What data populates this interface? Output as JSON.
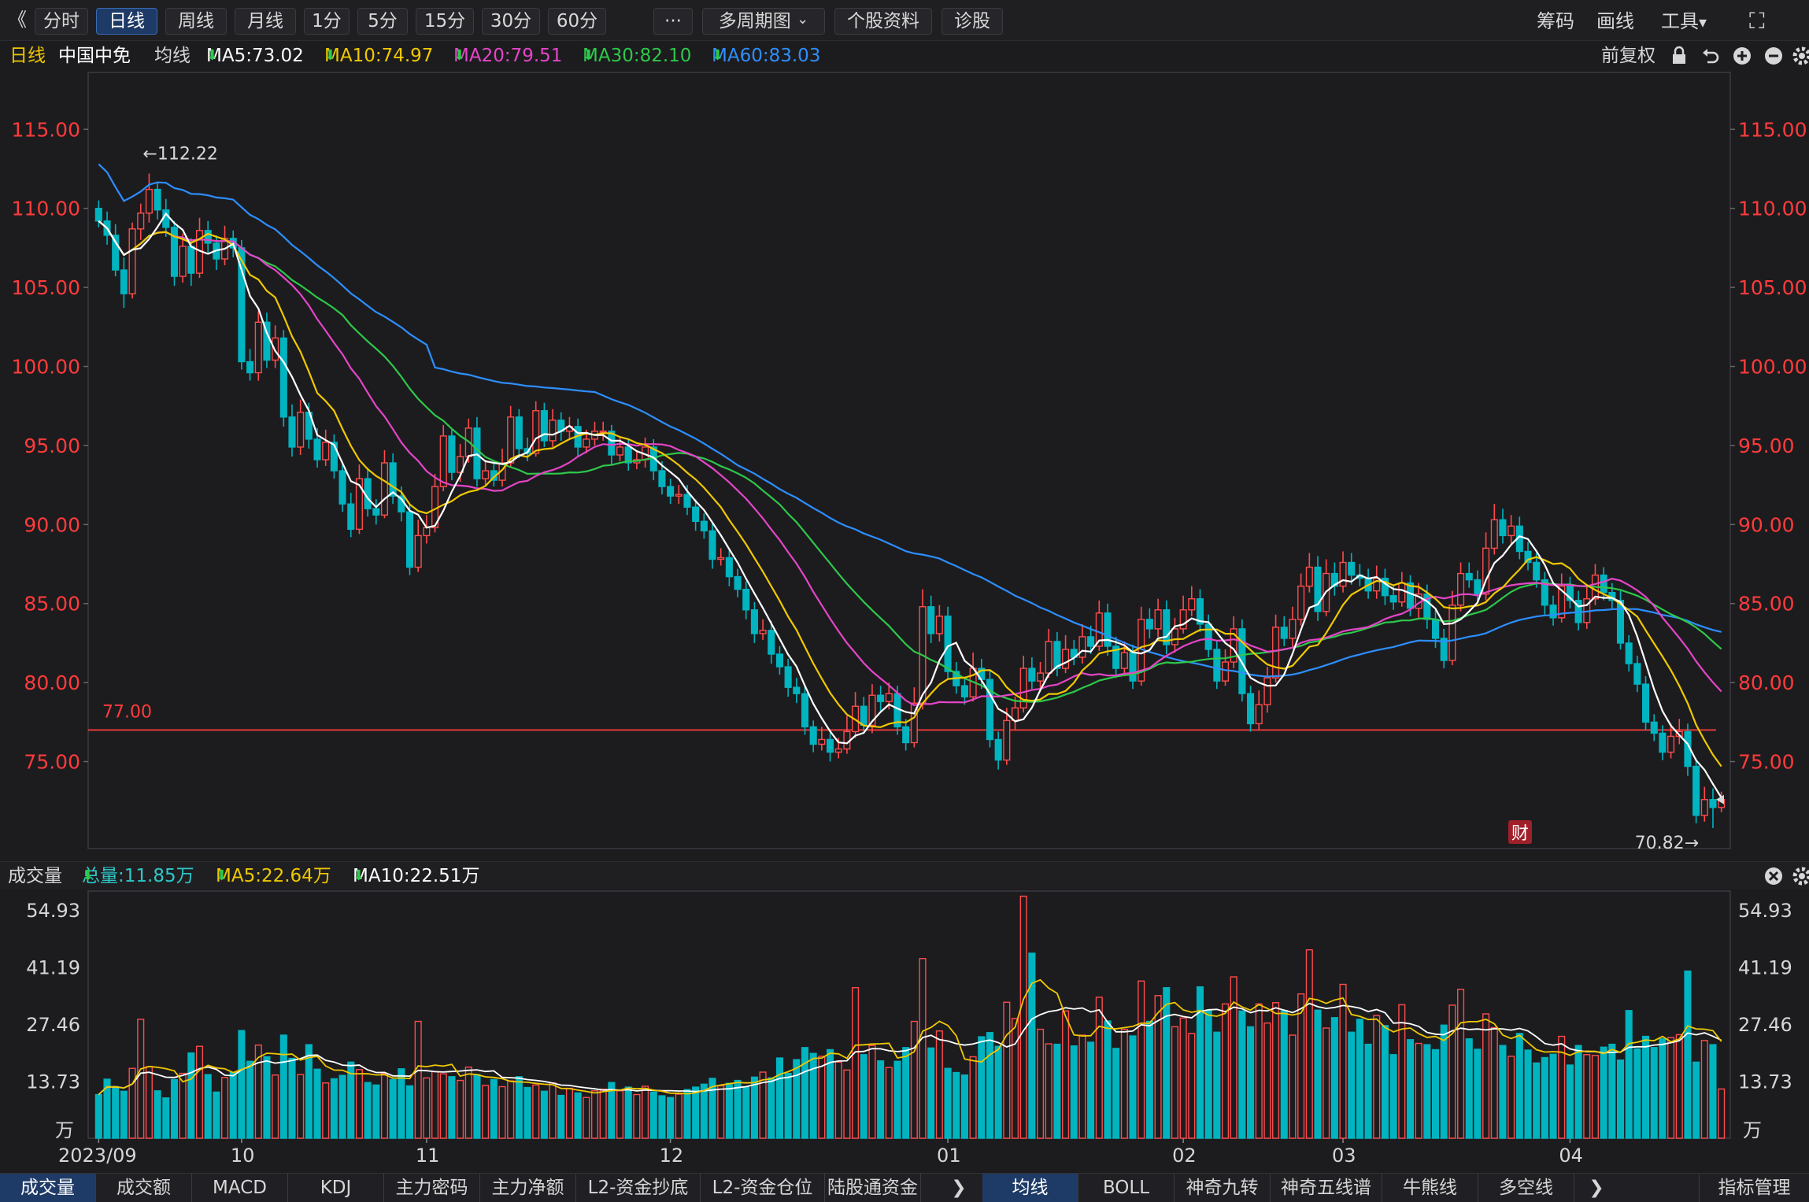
{
  "toolbar": {
    "collapse_glyph": "《",
    "periods": [
      "分时",
      "日线",
      "周线",
      "月线",
      "1分",
      "5分",
      "15分",
      "30分",
      "60分"
    ],
    "active_period": "日线",
    "more": "···",
    "multi_period": "多周期图",
    "dropdown_glyph": "⌄",
    "stock_info": "个股资料",
    "diagnose": "诊股",
    "right": [
      "筹码",
      "画线",
      "工具"
    ],
    "tools_caret": "▾",
    "fullscreen_icon": "⛶"
  },
  "infobar": {
    "period_label": "日线",
    "stock_name": "中国中免",
    "ma_label": "均线",
    "ma5": "MA5:73.02",
    "ma10": "MA10:74.97",
    "ma20": "MA20:79.51",
    "ma30": "MA30:82.10",
    "ma60": "MA60:83.03",
    "down_arrow": "⬇",
    "adjust": "前复权"
  },
  "volbar": {
    "title": "成交量",
    "total": "总量:11.85万",
    "ma5": "MA5:22.64万",
    "ma10": "MA10:22.51万",
    "down_arrow": "⬇"
  },
  "bottombar": {
    "left_tabs": [
      "成交量",
      "成交额",
      "MACD",
      "KDJ",
      "主力密码",
      "主力净额",
      "L2-资金抄底",
      "L2-资金仓位",
      "陆股通资金"
    ],
    "left_active": "成交量",
    "right_tabs": [
      "均线",
      "BOLL",
      "神奇九转",
      "神奇五线谱",
      "牛熊线",
      "多空线"
    ],
    "right_active": "均线",
    "next_glyph": "❯",
    "manage": "指标管理"
  },
  "colors": {
    "up": "#ff4b4b",
    "down": "#00b4c0",
    "ma5": "#ffffff",
    "ma10": "#f0c800",
    "ma20": "#e545c8",
    "ma30": "#2ec84a",
    "ma60": "#2d8fff",
    "price_label": "#ff3b3b",
    "refline": "#ff3b3b"
  },
  "chart_data": {
    "type": "candlestick",
    "price_axis": {
      "ticks": [
        "115.00",
        "110.00",
        "105.00",
        "100.00",
        "95.00",
        "90.00",
        "85.00",
        "80.00",
        "75.00"
      ]
    },
    "volume_axis": {
      "ticks": [
        "54.93",
        "41.19",
        "27.46",
        "13.73"
      ],
      "unit": "万"
    },
    "x_ticks": [
      {
        "label": "2023/09",
        "index": 0
      },
      {
        "label": "10",
        "index": 17
      },
      {
        "label": "11",
        "index": 39
      },
      {
        "label": "12",
        "index": 68
      },
      {
        "label": "01",
        "index": 101
      },
      {
        "label": "02",
        "index": 129
      },
      {
        "label": "03",
        "index": 148
      },
      {
        "label": "04",
        "index": 175
      }
    ],
    "reference_line": {
      "value": 77.0,
      "label": "77.00"
    },
    "high_marker": {
      "label": "←112.22",
      "index": 6
    },
    "low_marker": {
      "label": "70.82→",
      "index": 190
    },
    "finance_marker": "财",
    "volume_high": [
      54.93,
      13.73
    ],
    "candles": [
      [
        110.0,
        109.2,
        110.5,
        108.8,
        10.5
      ],
      [
        109.2,
        108.3,
        109.8,
        107.7,
        14.2
      ],
      [
        108.3,
        106.1,
        109.0,
        105.7,
        12.4
      ],
      [
        106.1,
        104.6,
        106.9,
        103.7,
        11.3
      ],
      [
        104.6,
        108.7,
        109.1,
        104.3,
        16.8
      ],
      [
        108.7,
        109.7,
        110.3,
        108.0,
        28.6
      ],
      [
        109.7,
        111.2,
        112.2,
        109.1,
        17.2
      ],
      [
        111.2,
        109.9,
        111.7,
        109.3,
        11.4
      ],
      [
        109.9,
        108.8,
        110.6,
        108.2,
        9.7
      ],
      [
        108.8,
        105.7,
        109.2,
        105.1,
        14.1
      ],
      [
        105.7,
        107.6,
        108.4,
        105.3,
        15.6
      ],
      [
        107.6,
        105.9,
        108.1,
        105.1,
        20.5
      ],
      [
        105.9,
        108.6,
        109.4,
        105.6,
        22.1
      ],
      [
        108.6,
        107.8,
        109.2,
        107.1,
        15.3
      ],
      [
        107.8,
        106.8,
        108.3,
        106.1,
        11.1
      ],
      [
        106.8,
        108.1,
        108.9,
        106.4,
        14.6
      ],
      [
        108.1,
        107.5,
        108.6,
        106.9,
        15.8
      ],
      [
        107.5,
        100.3,
        108.0,
        99.8,
        25.9
      ],
      [
        100.3,
        99.6,
        101.1,
        99.1,
        18.5
      ],
      [
        99.6,
        102.8,
        103.5,
        99.1,
        22.4
      ],
      [
        102.8,
        100.4,
        103.4,
        99.9,
        19.6
      ],
      [
        100.4,
        101.8,
        102.6,
        99.9,
        15.2
      ],
      [
        101.8,
        96.8,
        102.3,
        96.2,
        24.8
      ],
      [
        96.8,
        94.9,
        97.6,
        94.3,
        19.2
      ],
      [
        94.9,
        97.1,
        97.9,
        94.4,
        15.3
      ],
      [
        97.1,
        95.4,
        97.7,
        94.8,
        22.5
      ],
      [
        95.4,
        94.1,
        96.1,
        93.6,
        16.6
      ],
      [
        94.1,
        95.2,
        96.0,
        93.7,
        13.3
      ],
      [
        95.2,
        93.4,
        95.7,
        92.9,
        14.3
      ],
      [
        93.4,
        91.3,
        94.0,
        90.8,
        15.1
      ],
      [
        91.3,
        89.7,
        92.0,
        89.2,
        18.3
      ],
      [
        89.7,
        92.9,
        93.8,
        89.4,
        16.5
      ],
      [
        92.9,
        91.0,
        93.6,
        90.5,
        13.4
      ],
      [
        91.0,
        90.6,
        91.6,
        90.0,
        12.8
      ],
      [
        90.6,
        93.9,
        94.7,
        90.4,
        15.5
      ],
      [
        93.9,
        91.8,
        94.5,
        91.3,
        14.1
      ],
      [
        91.8,
        90.8,
        92.4,
        90.2,
        16.7
      ],
      [
        90.8,
        87.3,
        91.3,
        86.8,
        12.6
      ],
      [
        87.3,
        89.3,
        90.3,
        87.0,
        28.1
      ],
      [
        89.3,
        89.8,
        90.6,
        88.8,
        14.5
      ],
      [
        89.8,
        92.4,
        93.2,
        89.5,
        16.0
      ],
      [
        92.4,
        95.6,
        96.3,
        92.1,
        15.5
      ],
      [
        95.6,
        93.3,
        96.1,
        92.8,
        14.8
      ],
      [
        93.3,
        94.3,
        95.1,
        92.7,
        13.9
      ],
      [
        94.3,
        96.1,
        96.7,
        93.9,
        17.1
      ],
      [
        96.1,
        92.9,
        96.8,
        92.4,
        15.3
      ],
      [
        92.9,
        93.4,
        94.1,
        92.5,
        12.7
      ],
      [
        93.4,
        92.8,
        94.0,
        92.4,
        14.1
      ],
      [
        92.8,
        93.9,
        94.8,
        92.4,
        12.4
      ],
      [
        93.9,
        96.8,
        97.5,
        93.6,
        13.8
      ],
      [
        96.8,
        94.8,
        97.3,
        94.2,
        14.8
      ],
      [
        94.8,
        94.5,
        95.5,
        94.0,
        12.2
      ],
      [
        94.5,
        97.2,
        97.8,
        94.3,
        12.8
      ],
      [
        97.2,
        95.3,
        97.7,
        94.9,
        11.3
      ],
      [
        95.3,
        96.6,
        97.3,
        94.9,
        13.3
      ],
      [
        96.6,
        95.9,
        97.1,
        95.3,
        10.3
      ],
      [
        95.9,
        96.2,
        96.8,
        95.4,
        12.0
      ],
      [
        96.2,
        94.9,
        96.7,
        94.3,
        10.9
      ],
      [
        94.9,
        95.4,
        96.0,
        94.5,
        9.8
      ],
      [
        95.4,
        95.9,
        96.5,
        95.0,
        11.4
      ],
      [
        95.9,
        95.9,
        96.5,
        95.3,
        11.8
      ],
      [
        95.9,
        94.4,
        96.3,
        93.8,
        13.4
      ],
      [
        94.4,
        94.9,
        95.5,
        94.0,
        11.4
      ],
      [
        94.9,
        93.9,
        95.4,
        93.4,
        12.3
      ],
      [
        93.9,
        94.1,
        94.7,
        93.5,
        10.5
      ],
      [
        94.1,
        94.9,
        95.5,
        93.6,
        12.5
      ],
      [
        94.9,
        93.4,
        95.4,
        92.8,
        11.1
      ],
      [
        93.4,
        92.4,
        94.0,
        91.9,
        10.2
      ],
      [
        92.4,
        91.8,
        92.9,
        91.3,
        9.8
      ],
      [
        91.8,
        91.9,
        92.5,
        91.3,
        10.6
      ],
      [
        91.9,
        91.1,
        92.5,
        90.6,
        11.7
      ],
      [
        91.1,
        90.2,
        91.6,
        89.6,
        12.3
      ],
      [
        90.2,
        89.6,
        90.7,
        89.1,
        13.0
      ],
      [
        89.6,
        87.8,
        90.1,
        87.2,
        14.4
      ],
      [
        87.8,
        87.9,
        88.5,
        87.4,
        12.6
      ],
      [
        87.9,
        86.7,
        88.5,
        86.1,
        13.2
      ],
      [
        86.7,
        85.9,
        87.2,
        85.4,
        13.9
      ],
      [
        85.9,
        84.6,
        86.4,
        84.0,
        12.4
      ],
      [
        84.6,
        83.1,
        85.1,
        82.5,
        14.7
      ],
      [
        83.1,
        83.3,
        84.0,
        82.7,
        15.9
      ],
      [
        83.3,
        81.8,
        83.9,
        81.2,
        14.5
      ],
      [
        81.8,
        81.0,
        82.3,
        80.5,
        19.3
      ],
      [
        81.0,
        79.7,
        81.5,
        79.1,
        15.6
      ],
      [
        79.7,
        79.3,
        80.3,
        78.7,
        18.9
      ],
      [
        79.3,
        77.2,
        79.8,
        76.7,
        21.8
      ],
      [
        77.2,
        76.1,
        77.6,
        75.6,
        20.4
      ],
      [
        76.1,
        76.4,
        77.2,
        75.7,
        19.7
      ],
      [
        76.4,
        75.6,
        76.8,
        75.0,
        21.3
      ],
      [
        75.6,
        75.8,
        76.5,
        75.2,
        18.3
      ],
      [
        75.8,
        76.9,
        77.9,
        75.5,
        16.4
      ],
      [
        76.9,
        78.5,
        79.4,
        76.5,
        36.2
      ],
      [
        78.5,
        77.3,
        79.1,
        76.9,
        20.1
      ],
      [
        77.3,
        79.2,
        79.9,
        76.8,
        22.3
      ],
      [
        79.2,
        78.8,
        79.8,
        78.2,
        18.6
      ],
      [
        78.8,
        79.3,
        80.0,
        78.3,
        17.0
      ],
      [
        79.3,
        77.2,
        79.8,
        76.7,
        18.5
      ],
      [
        77.2,
        76.2,
        77.7,
        75.7,
        21.8
      ],
      [
        76.2,
        78.7,
        79.7,
        75.9,
        28.1
      ],
      [
        78.7,
        84.8,
        85.9,
        78.3,
        43.2
      ],
      [
        84.8,
        83.1,
        85.5,
        82.5,
        21.7
      ],
      [
        83.1,
        84.2,
        84.9,
        82.6,
        25.8
      ],
      [
        84.2,
        80.7,
        84.8,
        80.2,
        16.8
      ],
      [
        80.7,
        79.8,
        81.3,
        79.3,
        15.8
      ],
      [
        79.8,
        79.1,
        80.3,
        78.6,
        15.2
      ],
      [
        79.1,
        80.9,
        81.9,
        78.8,
        19.6
      ],
      [
        80.9,
        80.2,
        81.5,
        79.6,
        24.4
      ],
      [
        80.2,
        76.4,
        80.8,
        75.9,
        25.4
      ],
      [
        76.4,
        75.1,
        76.9,
        74.5,
        22.1
      ],
      [
        75.1,
        77.6,
        78.4,
        74.8,
        32.7
      ],
      [
        77.6,
        78.4,
        79.1,
        77.0,
        28.8
      ],
      [
        78.4,
        80.9,
        81.7,
        78.1,
        58.2
      ],
      [
        80.9,
        80.1,
        81.6,
        79.6,
        44.5
      ],
      [
        80.1,
        80.6,
        81.3,
        79.6,
        26.2
      ],
      [
        80.6,
        82.6,
        83.4,
        80.3,
        22.7
      ],
      [
        82.6,
        80.9,
        83.2,
        80.4,
        22.6
      ],
      [
        80.9,
        82.1,
        83.0,
        80.6,
        30.6
      ],
      [
        82.1,
        81.6,
        82.7,
        81.1,
        22.2
      ],
      [
        81.6,
        82.9,
        83.7,
        81.2,
        24.8
      ],
      [
        82.9,
        82.3,
        83.6,
        81.8,
        23.1
      ],
      [
        82.3,
        84.4,
        85.2,
        82.0,
        33.9
      ],
      [
        84.4,
        82.3,
        85.0,
        81.7,
        28.2
      ],
      [
        82.3,
        80.9,
        82.9,
        80.3,
        21.6
      ],
      [
        80.9,
        81.9,
        82.6,
        80.4,
        26.2
      ],
      [
        81.9,
        80.1,
        82.4,
        79.6,
        24.6
      ],
      [
        80.1,
        84.0,
        84.8,
        79.8,
        37.8
      ],
      [
        84.0,
        83.4,
        84.7,
        82.8,
        28.1
      ],
      [
        83.4,
        84.6,
        85.3,
        82.9,
        34.3
      ],
      [
        84.6,
        82.4,
        85.2,
        81.8,
        36.2
      ],
      [
        82.4,
        83.4,
        84.1,
        81.9,
        26.8
      ],
      [
        83.4,
        84.6,
        85.5,
        83.1,
        28.9
      ],
      [
        84.6,
        85.3,
        86.1,
        84.2,
        25.2
      ],
      [
        85.3,
        83.7,
        85.9,
        83.2,
        36.4
      ],
      [
        83.7,
        82.1,
        84.3,
        81.6,
        30.7
      ],
      [
        82.1,
        80.1,
        82.6,
        79.6,
        25.5
      ],
      [
        80.1,
        81.3,
        82.1,
        79.8,
        32.3
      ],
      [
        81.3,
        83.4,
        84.2,
        80.9,
        38.8
      ],
      [
        83.4,
        79.3,
        84.0,
        78.8,
        30.6
      ],
      [
        79.3,
        77.4,
        79.8,
        76.9,
        26.8
      ],
      [
        77.4,
        78.6,
        79.5,
        77.0,
        32.3
      ],
      [
        78.6,
        80.3,
        81.0,
        78.1,
        27.7
      ],
      [
        80.3,
        83.5,
        84.3,
        80.0,
        32.6
      ],
      [
        83.5,
        82.8,
        84.2,
        82.3,
        30.7
      ],
      [
        82.8,
        84.0,
        84.8,
        82.2,
        24.8
      ],
      [
        84.0,
        86.1,
        86.9,
        83.6,
        34.7
      ],
      [
        86.1,
        87.3,
        88.2,
        85.7,
        45.3
      ],
      [
        87.3,
        84.5,
        88.0,
        83.9,
        30.8
      ],
      [
        84.5,
        86.9,
        87.8,
        84.2,
        26.5
      ],
      [
        86.9,
        86.1,
        87.6,
        85.5,
        29.0
      ],
      [
        86.1,
        87.6,
        88.3,
        85.7,
        37.0
      ],
      [
        87.6,
        86.8,
        88.2,
        86.2,
        25.5
      ],
      [
        86.8,
        86.6,
        87.5,
        86.1,
        28.6
      ],
      [
        86.6,
        85.8,
        87.2,
        85.3,
        22.6
      ],
      [
        85.8,
        86.6,
        87.4,
        85.3,
        29.5
      ],
      [
        86.6,
        85.5,
        87.2,
        84.9,
        27.1
      ],
      [
        85.5,
        85.1,
        86.1,
        84.6,
        20.1
      ],
      [
        85.1,
        86.3,
        87.0,
        84.8,
        32.1
      ],
      [
        86.3,
        84.7,
        86.8,
        84.2,
        23.7
      ],
      [
        84.7,
        85.6,
        86.3,
        84.1,
        22.8
      ],
      [
        85.6,
        84.0,
        86.2,
        83.4,
        22.5
      ],
      [
        84.0,
        82.8,
        84.6,
        82.2,
        21.3
      ],
      [
        82.8,
        81.4,
        83.4,
        80.9,
        27.2
      ],
      [
        81.4,
        84.9,
        85.8,
        81.1,
        32.0
      ],
      [
        84.9,
        86.9,
        87.6,
        84.5,
        35.8
      ],
      [
        86.9,
        86.5,
        87.6,
        86.0,
        23.9
      ],
      [
        86.5,
        85.6,
        87.1,
        85.1,
        21.4
      ],
      [
        85.6,
        88.5,
        89.5,
        85.2,
        29.9
      ],
      [
        88.5,
        90.3,
        91.3,
        88.1,
        26.6
      ],
      [
        90.3,
        89.3,
        91.0,
        88.8,
        22.3
      ],
      [
        89.3,
        89.9,
        90.6,
        88.8,
        19.7
      ],
      [
        89.9,
        88.3,
        90.5,
        87.8,
        25.2
      ],
      [
        88.3,
        87.6,
        88.9,
        87.1,
        21.2
      ],
      [
        87.6,
        86.5,
        88.2,
        86.0,
        18.1
      ],
      [
        86.5,
        84.9,
        87.0,
        84.3,
        19.4
      ],
      [
        84.9,
        84.1,
        85.5,
        83.6,
        20.2
      ],
      [
        84.1,
        86.1,
        86.9,
        83.8,
        24.5
      ],
      [
        86.1,
        85.2,
        86.7,
        84.7,
        17.6
      ],
      [
        85.2,
        83.8,
        85.8,
        83.3,
        22.3
      ],
      [
        83.8,
        85.3,
        86.1,
        83.4,
        20.1
      ],
      [
        85.3,
        86.8,
        87.5,
        84.9,
        19.9
      ],
      [
        86.8,
        85.7,
        87.3,
        85.2,
        21.9
      ],
      [
        85.7,
        85.2,
        86.3,
        84.7,
        22.6
      ],
      [
        85.2,
        82.5,
        85.8,
        82.1,
        18.8
      ],
      [
        82.5,
        81.2,
        83.0,
        80.7,
        30.7
      ],
      [
        81.2,
        79.9,
        81.7,
        79.4,
        21.5
      ],
      [
        79.9,
        77.5,
        80.4,
        77.0,
        24.5
      ],
      [
        77.5,
        76.8,
        78.0,
        76.3,
        21.8
      ],
      [
        76.8,
        75.6,
        77.3,
        75.1,
        23.9
      ],
      [
        75.6,
        76.6,
        77.4,
        75.2,
        24.2
      ],
      [
        76.6,
        76.9,
        77.7,
        76.1,
        24.9
      ],
      [
        76.9,
        74.7,
        77.4,
        74.1,
        40.2
      ],
      [
        74.7,
        71.6,
        75.2,
        71.1,
        18.3
      ],
      [
        71.6,
        72.6,
        73.4,
        71.2,
        23.5
      ],
      [
        72.6,
        72.1,
        73.3,
        70.8,
        22.5
      ],
      [
        72.1,
        72.6,
        73.1,
        71.8,
        11.85
      ]
    ]
  }
}
